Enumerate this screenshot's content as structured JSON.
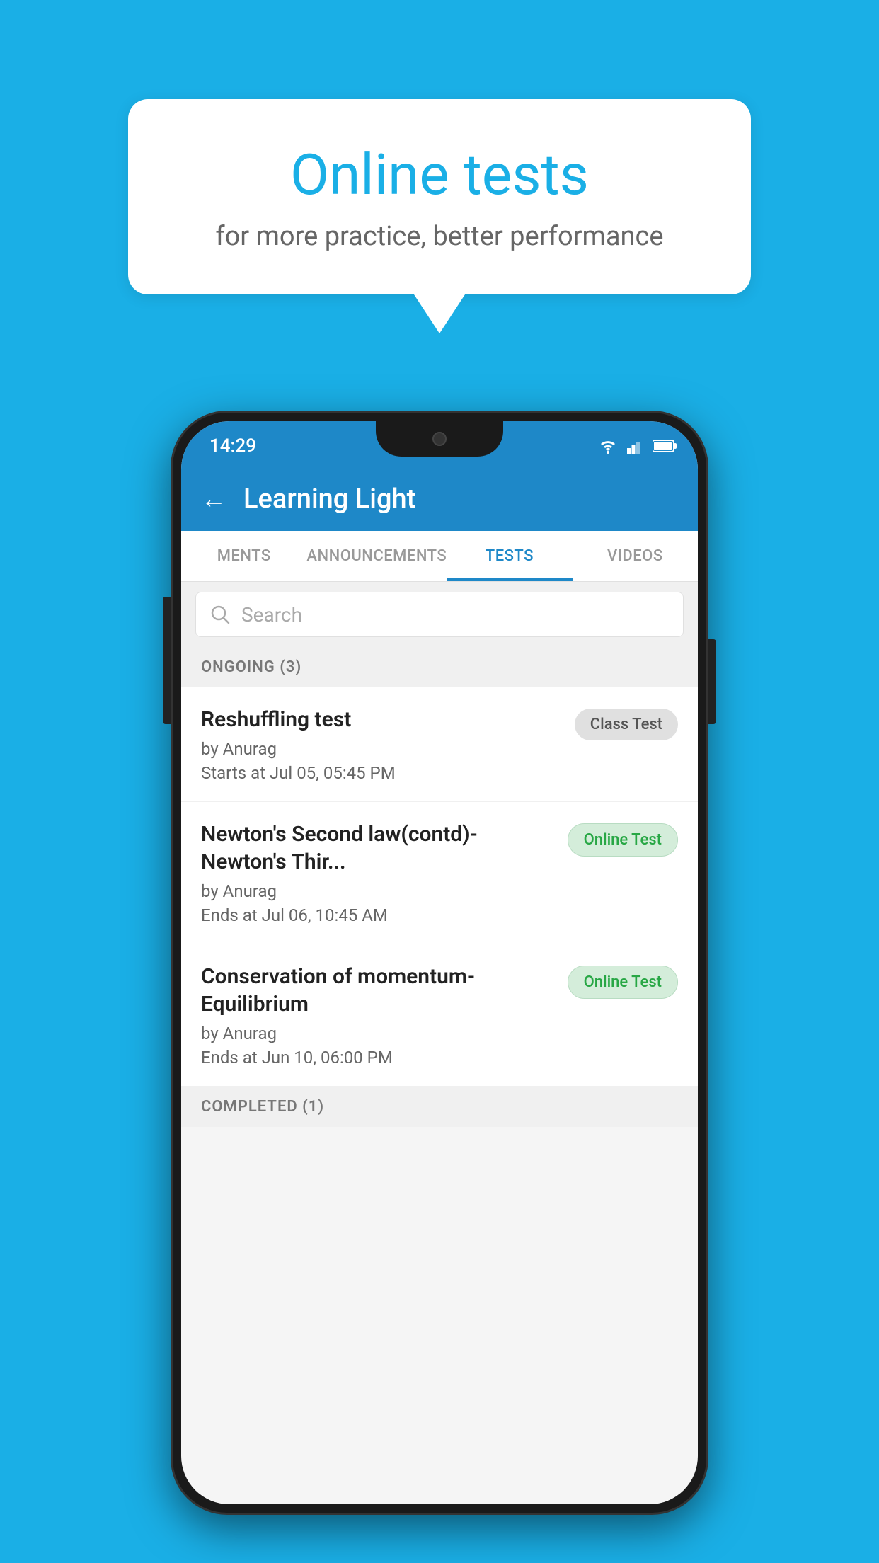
{
  "background_color": "#1AAFE6",
  "speech_bubble": {
    "title": "Online tests",
    "subtitle": "for more practice, better performance"
  },
  "phone": {
    "status_bar": {
      "time": "14:29"
    },
    "app_bar": {
      "title": "Learning Light",
      "back_label": "←"
    },
    "tabs": [
      {
        "label": "MENTS",
        "active": false
      },
      {
        "label": "ANNOUNCEMENTS",
        "active": false
      },
      {
        "label": "TESTS",
        "active": true
      },
      {
        "label": "VIDEOS",
        "active": false
      }
    ],
    "search": {
      "placeholder": "Search"
    },
    "ongoing_section": {
      "label": "ONGOING (3)"
    },
    "tests": [
      {
        "name": "Reshuffling test",
        "author": "by Anurag",
        "date": "Starts at  Jul 05, 05:45 PM",
        "badge": "Class Test",
        "badge_type": "class"
      },
      {
        "name": "Newton's Second law(contd)-Newton's Thir...",
        "author": "by Anurag",
        "date": "Ends at  Jul 06, 10:45 AM",
        "badge": "Online Test",
        "badge_type": "online"
      },
      {
        "name": "Conservation of momentum-Equilibrium",
        "author": "by Anurag",
        "date": "Ends at  Jun 10, 06:00 PM",
        "badge": "Online Test",
        "badge_type": "online"
      }
    ],
    "completed_section": {
      "label": "COMPLETED (1)"
    }
  }
}
